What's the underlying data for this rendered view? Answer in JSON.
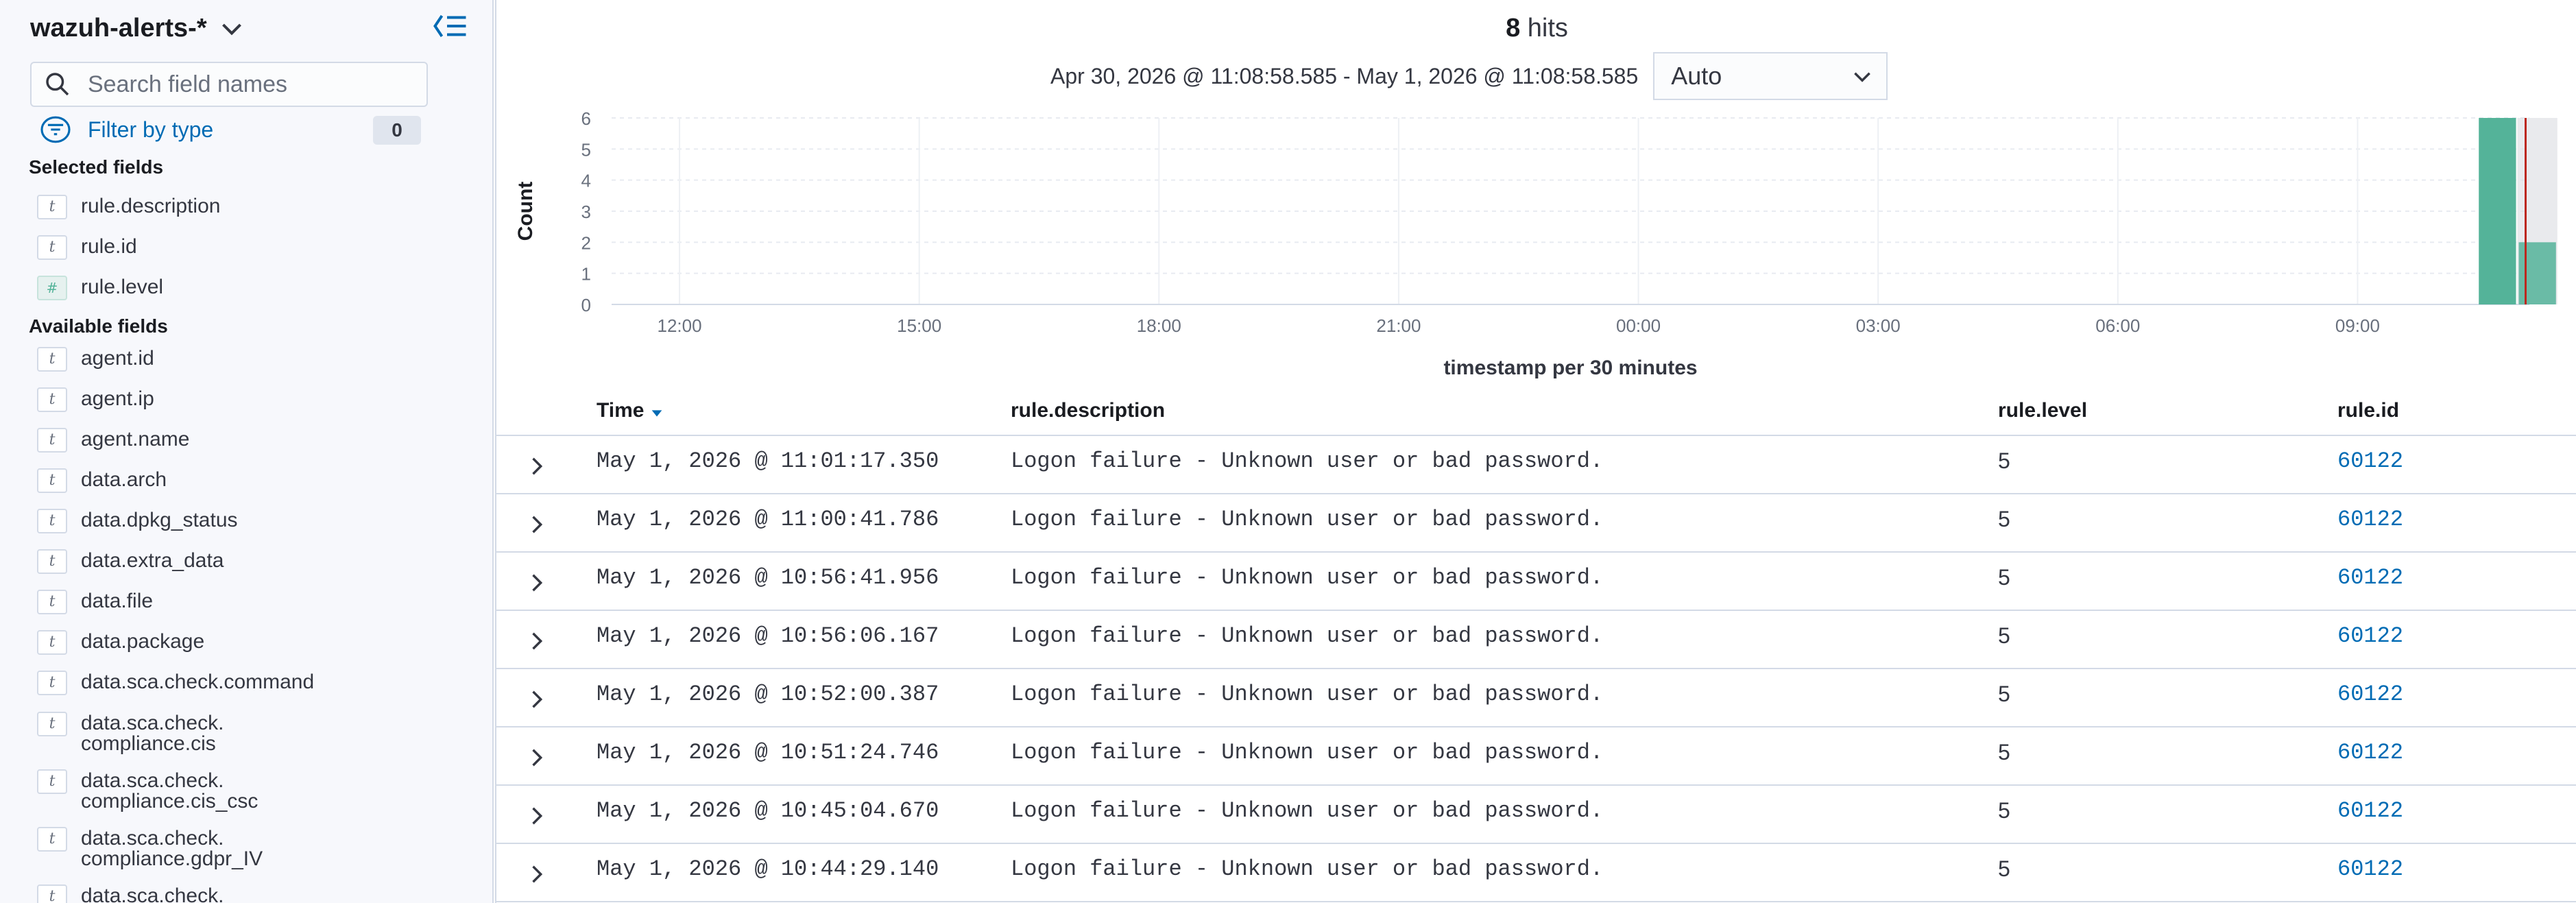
{
  "sidebar": {
    "index_pattern": "wazuh-alerts-*",
    "search_placeholder": "Search field names",
    "filter_label": "Filter by type",
    "filter_count": "0",
    "selected_heading": "Selected fields",
    "selected_fields": [
      {
        "type": "t",
        "name": "rule.description"
      },
      {
        "type": "t",
        "name": "rule.id"
      },
      {
        "type": "#",
        "name": "rule.level"
      }
    ],
    "available_heading": "Available fields",
    "available_fields": [
      {
        "type": "t",
        "name": "agent.id"
      },
      {
        "type": "t",
        "name": "agent.ip"
      },
      {
        "type": "t",
        "name": "agent.name"
      },
      {
        "type": "t",
        "name": "data.arch"
      },
      {
        "type": "t",
        "name": "data.dpkg_status"
      },
      {
        "type": "t",
        "name": "data.extra_data"
      },
      {
        "type": "t",
        "name": "data.file"
      },
      {
        "type": "t",
        "name": "data.package"
      },
      {
        "type": "t",
        "name": "data.sca.check.command"
      },
      {
        "type": "t",
        "line1": "data.sca.check.",
        "line2": "compliance.cis"
      },
      {
        "type": "t",
        "line1": "data.sca.check.",
        "line2": "compliance.cis_csc"
      },
      {
        "type": "t",
        "line1": "data.sca.check.",
        "line2": "compliance.gdpr_IV"
      },
      {
        "type": "t",
        "line1": "data.sca.check.",
        "line2": ""
      }
    ]
  },
  "main": {
    "hits_count": "8",
    "hits_label": "hits",
    "time_range": "Apr 30, 2026 @ 11:08:58.585 - May 1, 2026 @ 11:08:58.585",
    "interval": "Auto"
  },
  "chart_data": {
    "type": "bar",
    "title": "",
    "ylabel": "Count",
    "xlabel": "timestamp per 30 minutes",
    "ylim": [
      0,
      6
    ],
    "y_ticks": [
      "0",
      "1",
      "2",
      "3",
      "4",
      "5",
      "6"
    ],
    "x_ticks": [
      "12:00",
      "15:00",
      "18:00",
      "21:00",
      "00:00",
      "03:00",
      "06:00",
      "09:00"
    ],
    "x_range_hours": [
      11.15,
      35.15
    ],
    "categories": [
      "10:30",
      "11:00"
    ],
    "bar_start_hours": [
      34.5,
      35.0
    ],
    "values": [
      6,
      2
    ],
    "colors": {
      "bar": "#54b399",
      "now_line": "#bd271e",
      "partial_bucket": "#e0e1e5"
    },
    "grid": true
  },
  "table": {
    "columns": [
      "Time",
      "rule.description",
      "rule.level",
      "rule.id"
    ],
    "rows": [
      {
        "time": "May 1, 2026 @ 11:01:17.350",
        "description": "Logon failure - Unknown user or bad password.",
        "level": "5",
        "id": "60122"
      },
      {
        "time": "May 1, 2026 @ 11:00:41.786",
        "description": "Logon failure - Unknown user or bad password.",
        "level": "5",
        "id": "60122"
      },
      {
        "time": "May 1, 2026 @ 10:56:41.956",
        "description": "Logon failure - Unknown user or bad password.",
        "level": "5",
        "id": "60122"
      },
      {
        "time": "May 1, 2026 @ 10:56:06.167",
        "description": "Logon failure - Unknown user or bad password.",
        "level": "5",
        "id": "60122"
      },
      {
        "time": "May 1, 2026 @ 10:52:00.387",
        "description": "Logon failure - Unknown user or bad password.",
        "level": "5",
        "id": "60122"
      },
      {
        "time": "May 1, 2026 @ 10:51:24.746",
        "description": "Logon failure - Unknown user or bad password.",
        "level": "5",
        "id": "60122"
      },
      {
        "time": "May 1, 2026 @ 10:45:04.670",
        "description": "Logon failure - Unknown user or bad password.",
        "level": "5",
        "id": "60122"
      },
      {
        "time": "May 1, 2026 @ 10:44:29.140",
        "description": "Logon failure - Unknown user or bad password.",
        "level": "5",
        "id": "60122"
      }
    ]
  }
}
